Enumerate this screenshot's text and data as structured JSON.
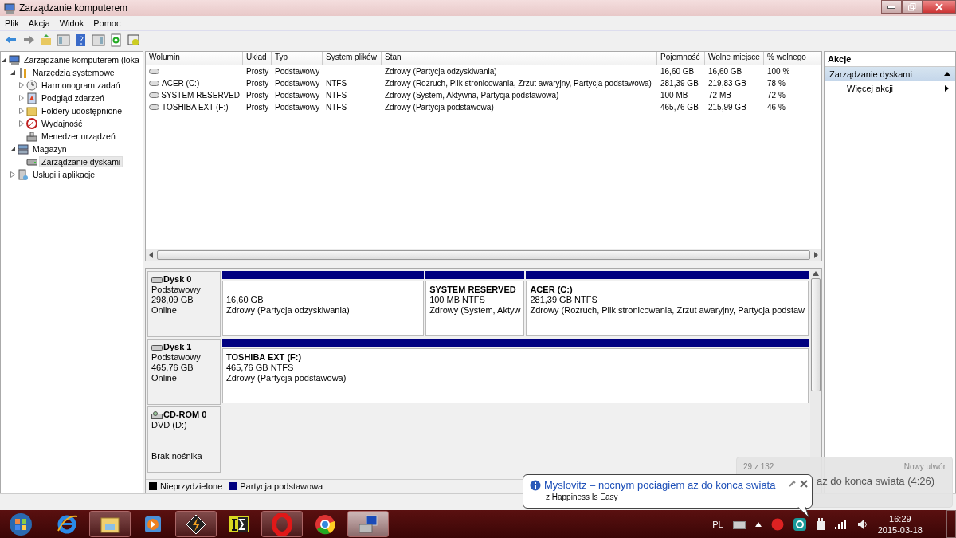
{
  "window": {
    "title": "Zarządzanie komputerem"
  },
  "menu": [
    "Plik",
    "Akcja",
    "Widok",
    "Pomoc"
  ],
  "toolbar": [
    {
      "kind": "back",
      "disabled": false
    },
    {
      "kind": "forward",
      "disabled": false
    },
    {
      "kind": "up",
      "disabled": false
    },
    {
      "kind": "tree",
      "disabled": false
    },
    {
      "kind": "help",
      "disabled": false
    },
    {
      "kind": "pane",
      "disabled": false
    },
    {
      "kind": "refresh",
      "disabled": false
    },
    {
      "kind": "props",
      "disabled": false
    }
  ],
  "tree": [
    {
      "label": "Zarządzanie komputerem (loka",
      "expanded": true,
      "selected": false,
      "children": [
        {
          "label": "Narzędzia systemowe",
          "expanded": true,
          "selected": false,
          "children": [
            {
              "label": "Harmonogram zadań",
              "expanded": false,
              "selected": false
            },
            {
              "label": "Podgląd zdarzeń",
              "expanded": false,
              "selected": false
            },
            {
              "label": "Foldery udostępnione",
              "expanded": false,
              "selected": false
            },
            {
              "label": "Wydajność",
              "expanded": false,
              "selected": false
            },
            {
              "label": "Menedżer urządzeń",
              "selected": false
            }
          ]
        },
        {
          "label": "Magazyn",
          "expanded": true,
          "selected": false,
          "children": [
            {
              "label": "Zarządzanie dyskami",
              "selected": true
            }
          ]
        },
        {
          "label": "Usługi i aplikacje",
          "expanded": false,
          "selected": false
        }
      ]
    }
  ],
  "table": {
    "columns": [
      "Wolumin",
      "Układ",
      "Typ",
      "System plików",
      "Stan",
      "Pojemność",
      "Wolne miejsce",
      "% wolnego"
    ],
    "rows": [
      [
        "",
        "Prosty",
        "Podstawowy",
        "",
        "Zdrowy (Partycja odzyskiwania)",
        "16,60 GB",
        "16,60 GB",
        "100 %"
      ],
      [
        "ACER (C:)",
        "Prosty",
        "Podstawowy",
        "NTFS",
        "Zdrowy (Rozruch, Plik stronicowania, Zrzut awaryjny, Partycja podstawowa)",
        "281,39 GB",
        "219,83 GB",
        "78 %"
      ],
      [
        "SYSTEM RESERVED",
        "Prosty",
        "Podstawowy",
        "NTFS",
        "Zdrowy (System, Aktywna, Partycja podstawowa)",
        "100 MB",
        "72 MB",
        "72 %"
      ],
      [
        "TOSHIBA EXT (F:)",
        "Prosty",
        "Podstawowy",
        "NTFS",
        "Zdrowy (Partycja podstawowa)",
        "465,76 GB",
        "215,99 GB",
        "46 %"
      ]
    ]
  },
  "disks": [
    {
      "kind": "disk",
      "name": "Dysk 0",
      "type": "Podstawowy",
      "size": "298,09 GB",
      "status": "Online",
      "partitions": [
        {
          "size": "16,60 GB",
          "status": "Zdrowy (Partycja odzyskiwania)"
        },
        {
          "name": "SYSTEM RESERVED",
          "size": "100 MB NTFS",
          "status": "Zdrowy (System, Aktyw"
        },
        {
          "name": "ACER  (C:)",
          "size": "281,39 GB NTFS",
          "status": "Zdrowy (Rozruch, Plik stronicowania, Zrzut awaryjny, Partycja podstaw"
        }
      ]
    },
    {
      "kind": "disk",
      "name": "Dysk 1",
      "type": "Podstawowy",
      "size": "465,76 GB",
      "status": "Online",
      "partitions": [
        {
          "name": "TOSHIBA EXT  (F:)",
          "size": "465,76 GB NTFS",
          "status": "Zdrowy (Partycja podstawowa)"
        }
      ]
    },
    {
      "kind": "cdrom",
      "name": "CD-ROM 0",
      "type": "DVD (D:)",
      "status": "Brak nośnika"
    }
  ],
  "legend": [
    {
      "label": "Nieprzydzielone",
      "color": "#000000"
    },
    {
      "label": "Partycja podstawowa",
      "color": "#000080"
    }
  ],
  "actions": {
    "header": "Akcje",
    "section": {
      "label": "Zarządzanie dyskami",
      "expanded": true
    },
    "items": [
      "Więcej akcji"
    ]
  },
  "media_popup": {
    "counter": "29 z 132",
    "heading": "Nowy utwór",
    "track": "az do konca swiata (4:26)"
  },
  "balloon": {
    "title": "Myslovitz – nocnym pociagiem az do konca swiata",
    "subtitle": "z Happiness Is Easy"
  },
  "taskbar": {
    "apps": [
      {
        "kind": "ie",
        "running": false
      },
      {
        "kind": "explorer",
        "running": true
      },
      {
        "kind": "player",
        "running": false
      },
      {
        "kind": "winamp",
        "running": true
      },
      {
        "kind": "sigma",
        "running": false
      },
      {
        "kind": "opera",
        "running": true
      },
      {
        "kind": "chrome",
        "running": false
      },
      {
        "kind": "compmgmt",
        "running": true
      }
    ],
    "language": "PL",
    "time": "16:29",
    "date": "2015-03-18"
  }
}
